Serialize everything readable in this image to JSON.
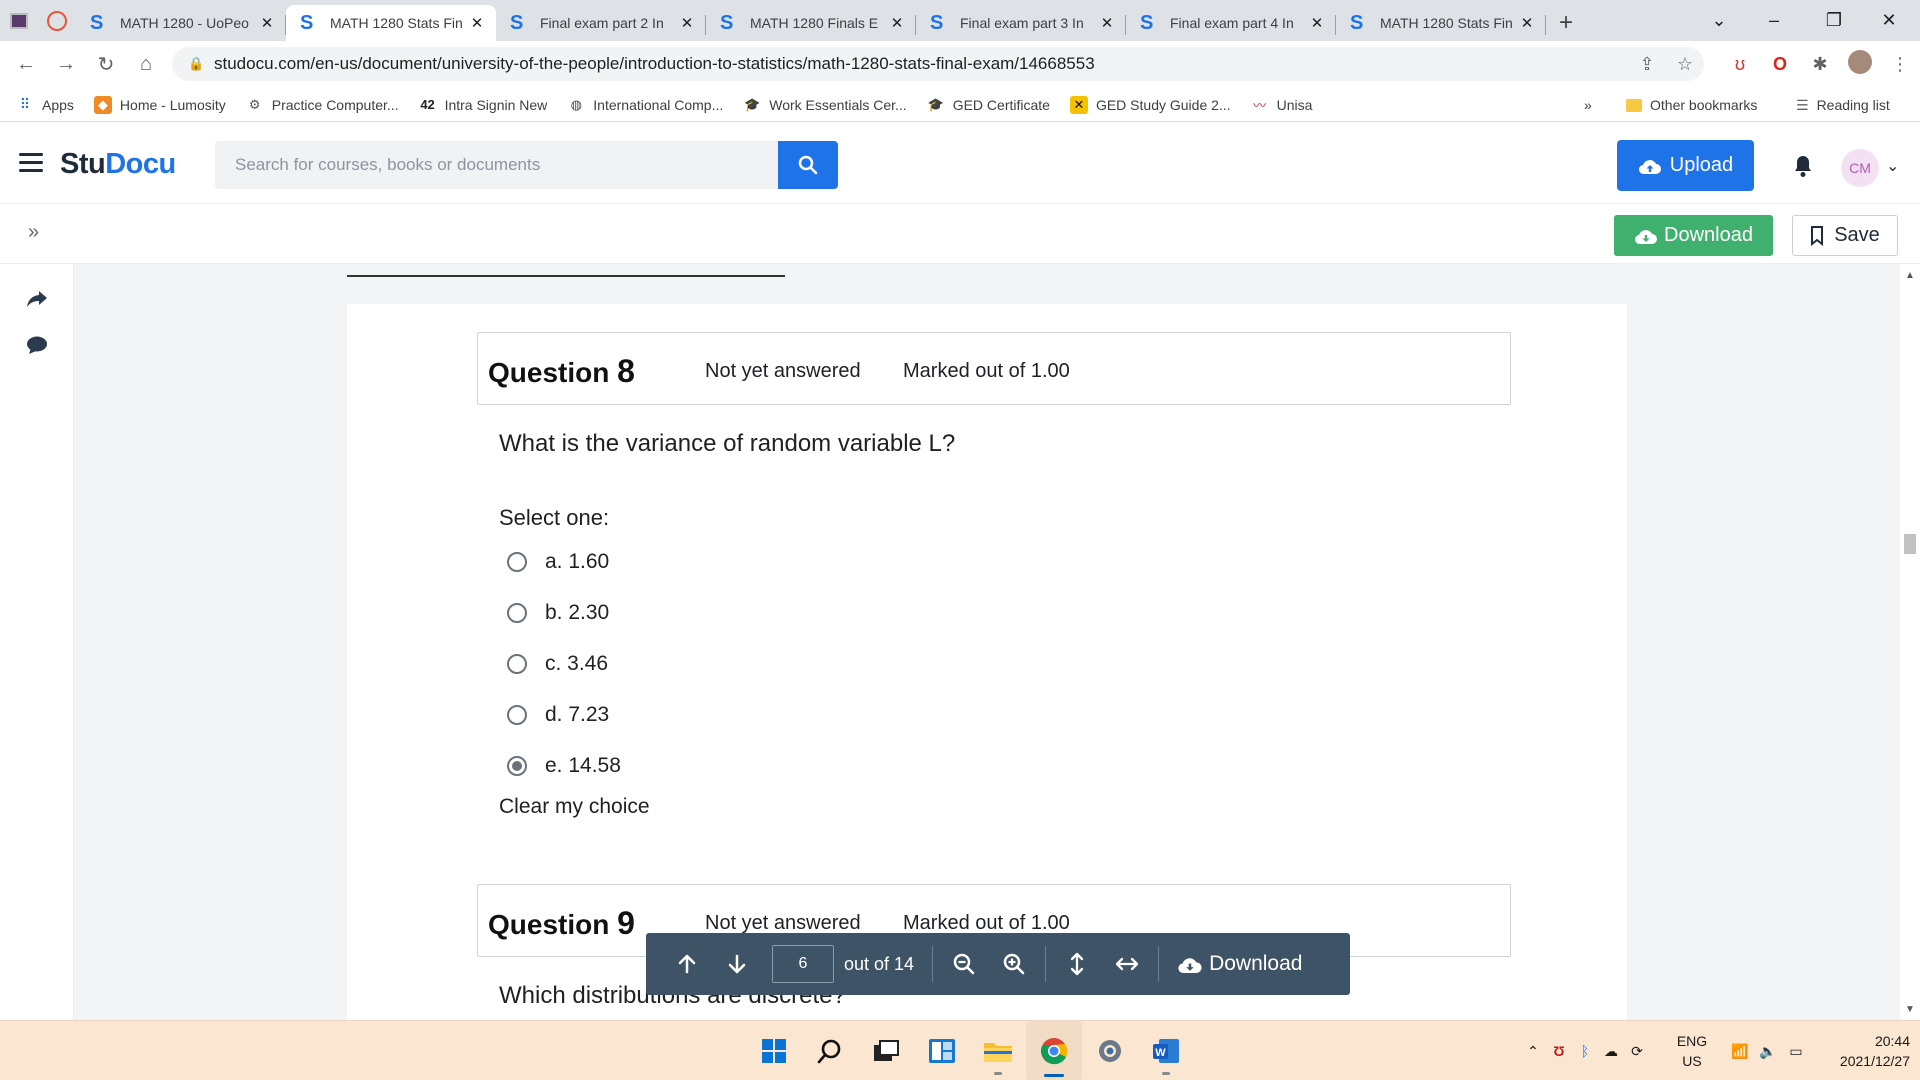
{
  "browser": {
    "tabs": [
      {
        "label": "MATH 1280 - UoPeo",
        "active": false
      },
      {
        "label": "MATH 1280 Stats Fin",
        "active": true
      },
      {
        "label": "Final exam part 2 In",
        "active": false
      },
      {
        "label": "MATH 1280 Finals E",
        "active": false
      },
      {
        "label": "Final exam part 3 In",
        "active": false
      },
      {
        "label": "Final exam part 4 In",
        "active": false
      },
      {
        "label": "MATH 1280 Stats Fin",
        "active": false
      }
    ],
    "url": "studocu.com/en-us/document/university-of-the-people/introduction-to-statistics/math-1280-stats-final-exam/14668553",
    "bookmarks": [
      {
        "label": "Apps",
        "icon": "apps-grid-icon"
      },
      {
        "label": "Home - Lumosity",
        "icon": "lumosity-icon"
      },
      {
        "label": "Practice Computer...",
        "icon": "gear-globe-icon"
      },
      {
        "label": "Intra Signin New",
        "icon": "intra-icon"
      },
      {
        "label": "International Comp...",
        "icon": "globe-icon"
      },
      {
        "label": "Work Essentials Cer...",
        "icon": "grad-cap-icon"
      },
      {
        "label": "GED Certificate",
        "icon": "grad-cap-icon"
      },
      {
        "label": "GED Study Guide 2...",
        "icon": "x-logo-icon"
      },
      {
        "label": "Unisa",
        "icon": "unisa-icon"
      }
    ],
    "bookmarks_overflow": "»",
    "other_bookmarks": "Other bookmarks",
    "reading_list": "Reading list"
  },
  "studocu": {
    "logo_stu": "Stu",
    "logo_docu": "Docu",
    "search_placeholder": "Search for courses, books or documents",
    "upload_label": "Upload",
    "avatar_initials": "CM",
    "download_label": "Download",
    "save_label": "Save"
  },
  "document": {
    "questions": [
      {
        "label": "Question",
        "number": "8",
        "status": "Not yet answered",
        "marked": "Marked out of 1.00",
        "text": "What is the variance of random variable L?",
        "select_label": "Select one:",
        "options": [
          {
            "label": "a. 1.60",
            "checked": false
          },
          {
            "label": "b. 2.30",
            "checked": false
          },
          {
            "label": "c. 3.46",
            "checked": false
          },
          {
            "label": "d. 7.23",
            "checked": false
          },
          {
            "label": "e. 14.58",
            "checked": true
          }
        ],
        "clear_label": "Clear my choice"
      },
      {
        "label": "Question",
        "number": "9",
        "status": "Not yet answered",
        "marked": "Marked out of 1.00",
        "text": "Which distributions are discrete?"
      }
    ]
  },
  "pager": {
    "current_page": "6",
    "out_of": "out of 14",
    "download_label": "Download"
  },
  "taskbar": {
    "lang_top": "ENG",
    "lang_bottom": "US",
    "time": "20:44",
    "date": "2021/12/27"
  },
  "colors": {
    "studocu_blue": "#1f73e8",
    "download_green": "#3fb06d",
    "pager_bg": "#3f5366",
    "taskbar_bg": "#fbe6d2"
  }
}
